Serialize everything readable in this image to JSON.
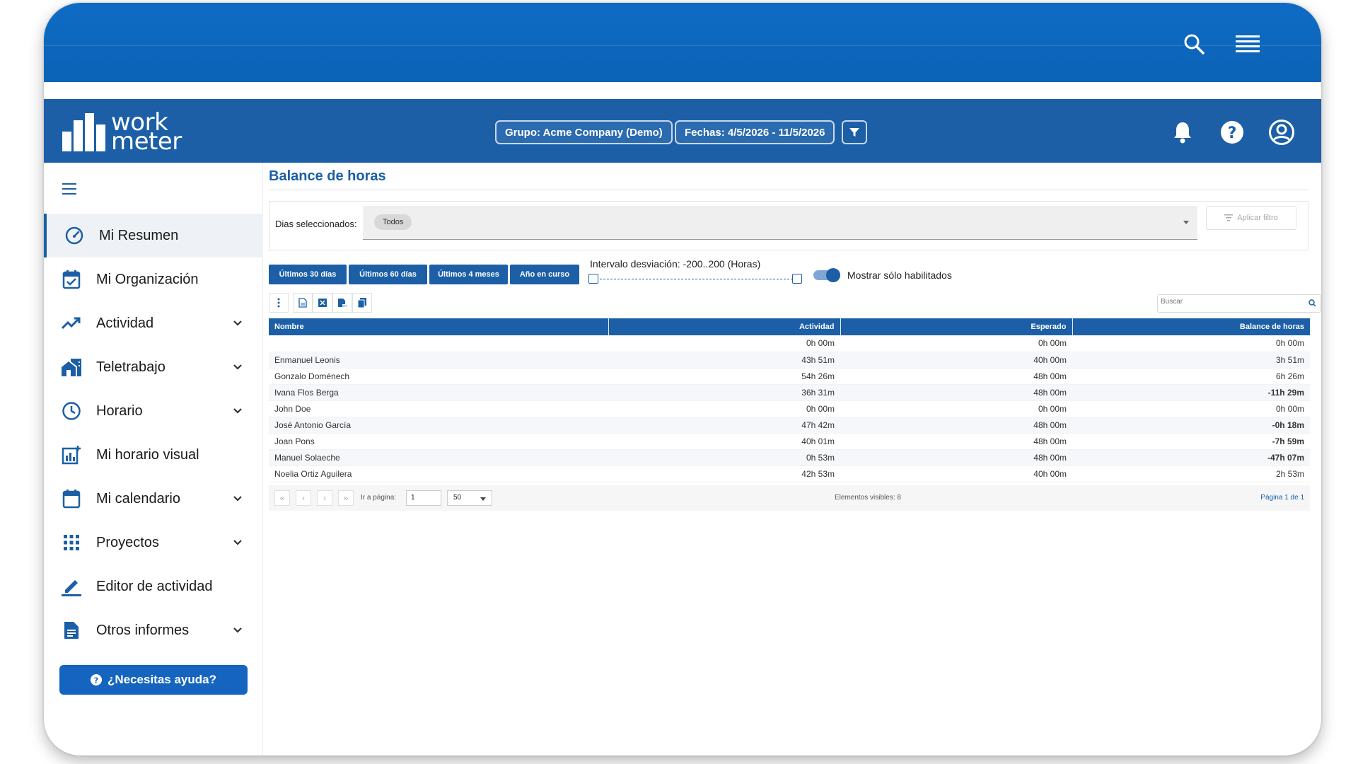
{
  "header": {
    "logo_line1": "work",
    "logo_line2": "meter",
    "group_label": "Grupo: Acme Company (Demo)",
    "dates_label": "Fechas: 4/5/2026 - 11/5/2026"
  },
  "sidebar": {
    "items": [
      {
        "label": "Mi Resumen",
        "icon": "gauge-icon",
        "active": true,
        "expandable": false
      },
      {
        "label": "Mi Organización",
        "icon": "calendar-check-icon",
        "active": false,
        "expandable": false
      },
      {
        "label": "Actividad",
        "icon": "trending-up-icon",
        "active": false,
        "expandable": true
      },
      {
        "label": "Teletrabajo",
        "icon": "home-work-icon",
        "active": false,
        "expandable": true
      },
      {
        "label": "Horario",
        "icon": "clock-icon",
        "active": false,
        "expandable": true
      },
      {
        "label": "Mi horario visual",
        "icon": "chart-add-icon",
        "active": false,
        "expandable": false
      },
      {
        "label": "Mi calendario",
        "icon": "calendar-icon",
        "active": false,
        "expandable": true
      },
      {
        "label": "Proyectos",
        "icon": "grid-icon",
        "active": false,
        "expandable": true
      },
      {
        "label": "Editor de actividad",
        "icon": "pencil-icon",
        "active": false,
        "expandable": false
      },
      {
        "label": "Otros informes",
        "icon": "document-icon",
        "active": false,
        "expandable": true
      }
    ],
    "help_label": "¿Necesitas ayuda?"
  },
  "main": {
    "title": "Balance de horas",
    "filter_label": "Dias seleccionados:",
    "filter_chip": "Todos",
    "apply_label": "Aplicar filtro",
    "range_buttons": [
      "Últimos 30 días",
      "Últimos 60 días",
      "Últimos 4 meses",
      "Año en curso"
    ],
    "slider_label": "Intervalo desviación: -200..200 (Horas)",
    "toggle_label": "Mostrar sólo habilitados",
    "toggle_on": true,
    "search_placeholder": "Buscar"
  },
  "table": {
    "columns": [
      "Nombre",
      "Actividad",
      "Esperado",
      "Balance de horas"
    ],
    "rows": [
      {
        "name": "",
        "actividad": "0h 00m",
        "esperado": "0h 00m",
        "balance": "0h 00m",
        "negative": false
      },
      {
        "name": "Enmanuel Leonis",
        "actividad": "43h 51m",
        "esperado": "40h 00m",
        "balance": "3h 51m",
        "negative": false
      },
      {
        "name": "Gonzalo Doménech",
        "actividad": "54h 26m",
        "esperado": "48h 00m",
        "balance": "6h 26m",
        "negative": false
      },
      {
        "name": "Ivana Flos Berga",
        "actividad": "36h 31m",
        "esperado": "48h 00m",
        "balance": "-11h 29m",
        "negative": true
      },
      {
        "name": "John Doe",
        "actividad": "0h 00m",
        "esperado": "0h 00m",
        "balance": "0h 00m",
        "negative": false
      },
      {
        "name": "José Antonio García",
        "actividad": "47h 42m",
        "esperado": "48h 00m",
        "balance": "-0h 18m",
        "negative": true
      },
      {
        "name": "Joan Pons",
        "actividad": "40h 01m",
        "esperado": "48h 00m",
        "balance": "-7h 59m",
        "negative": true
      },
      {
        "name": "Manuel Solaeche",
        "actividad": "0h 53m",
        "esperado": "48h 00m",
        "balance": "-47h 07m",
        "negative": true
      },
      {
        "name": "Noelia Ortiz Aguilera",
        "actividad": "42h 53m",
        "esperado": "40h 00m",
        "balance": "2h 53m",
        "negative": false
      }
    ]
  },
  "pager": {
    "goto_label": "Ir a página:",
    "page_value": "1",
    "page_size": "50",
    "visible_label": "Elementos visibles: 8",
    "page_of": "Página 1 de 1"
  },
  "colors": {
    "brand": "#1c5fa6",
    "topbar": "#0e6bc4",
    "negative": "#e00000"
  }
}
